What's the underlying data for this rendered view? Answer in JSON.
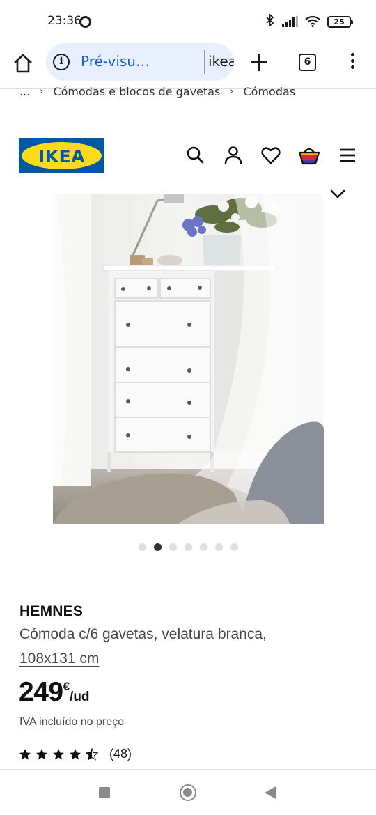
{
  "status_bar": {
    "time": "23:36",
    "battery_level": "25",
    "icons": [
      "bluetooth-icon",
      "signal-icon",
      "wifi-icon",
      "battery-icon"
    ]
  },
  "browser": {
    "url_preview_label": "Pré-visu…",
    "url_domain": "ikea.com/",
    "tab_count": "6",
    "accent_color": "#1a5fcf",
    "pill_color": "#e8f0fe"
  },
  "breadcrumb": {
    "items": [
      "...",
      "Cómodas e blocos de gavetas",
      "Cómodas"
    ]
  },
  "header": {
    "logo_text": "IKEA",
    "logo_colors": {
      "blue": "#0058a3",
      "yellow": "#ffda1a"
    },
    "icons": [
      "search-icon",
      "account-icon",
      "favourites-icon",
      "cart-icon",
      "hamburger-menu-icon"
    ]
  },
  "gallery": {
    "total_images": 7,
    "active_index": 1
  },
  "product": {
    "name": "HEMNES",
    "description": "Cómoda c/6 gavetas, velatura branca,",
    "dimensions": "108x131 cm",
    "price_integer": "249",
    "price_currency": "€",
    "price_unit": "/ud",
    "vat_note": "IVA incluído no preço",
    "rating_value": 4.5,
    "rating_max": 5,
    "review_count": "(48)"
  },
  "android_nav": {
    "buttons": [
      "recents-button",
      "home-button",
      "back-button"
    ]
  }
}
